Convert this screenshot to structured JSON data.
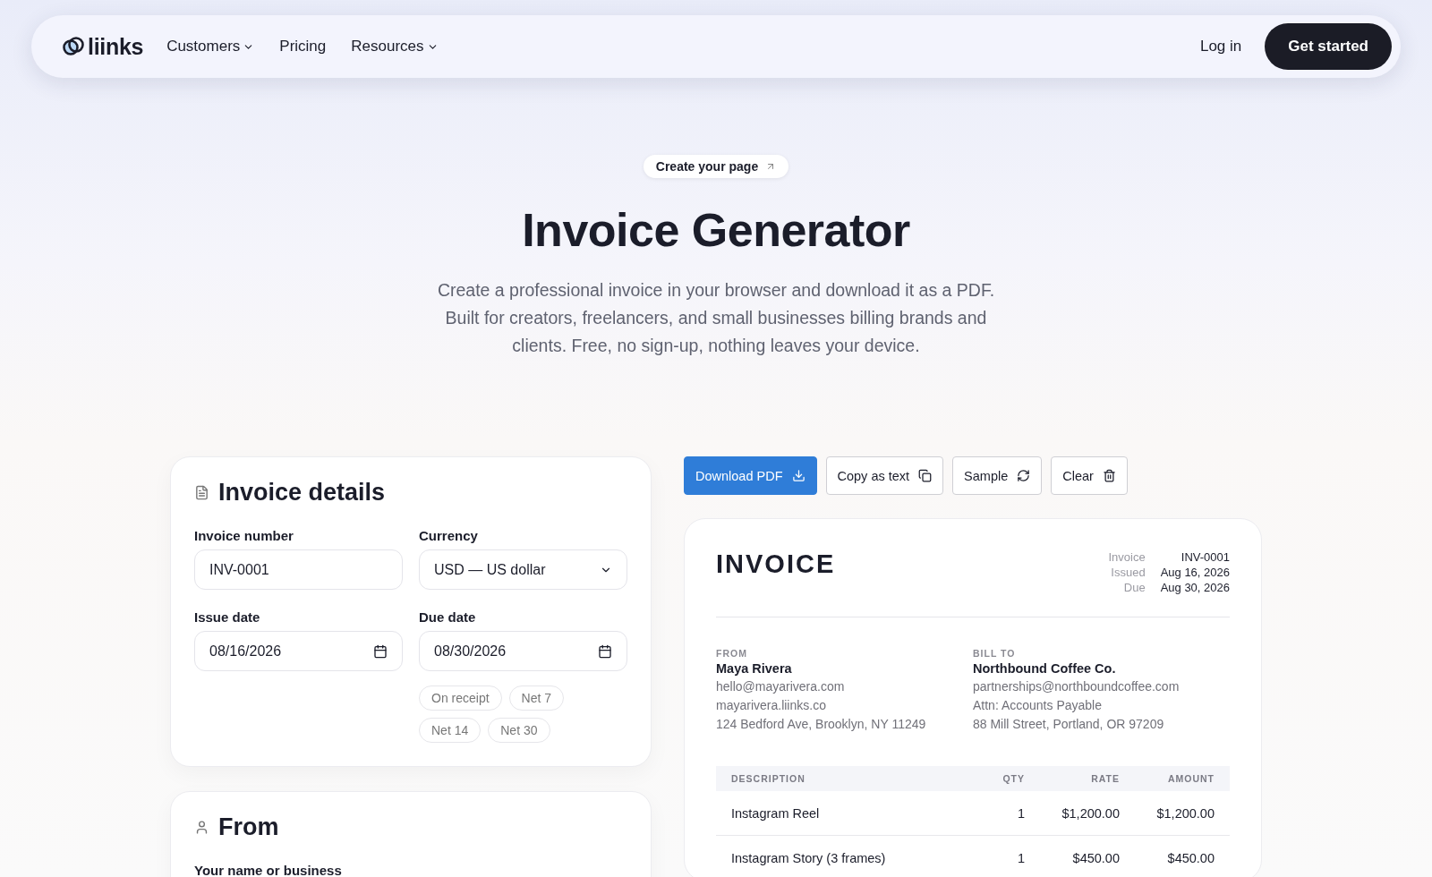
{
  "nav": {
    "logo": "liinks",
    "links": [
      {
        "label": "Customers",
        "dropdown": true
      },
      {
        "label": "Pricing",
        "dropdown": false
      },
      {
        "label": "Resources",
        "dropdown": true
      }
    ],
    "login": "Log in",
    "cta": "Get started"
  },
  "hero": {
    "badge": "Create your page",
    "title": "Invoice Generator",
    "subtitle": "Create a professional invoice in your browser and download it as a PDF. Built for creators, freelancers, and small businesses billing brands and clients. Free, no sign-up, nothing leaves your device."
  },
  "details": {
    "title": "Invoice details",
    "fields": [
      {
        "label": "Invoice number",
        "value": "INV-0001",
        "kind": "text"
      },
      {
        "label": "Currency",
        "value": "USD — US dollar",
        "kind": "select"
      },
      {
        "label": "Issue date",
        "value": "08/16/2026",
        "kind": "date"
      },
      {
        "label": "Due date",
        "value": "08/30/2026",
        "kind": "date"
      }
    ],
    "terms": [
      "On receipt",
      "Net 7",
      "Net 14",
      "Net 30"
    ]
  },
  "from_card": {
    "title": "From",
    "field_label": "Your name or business"
  },
  "actions": [
    {
      "label": "Download PDF",
      "kind": "primary"
    },
    {
      "label": "Copy as text",
      "kind": "secondary"
    },
    {
      "label": "Sample",
      "kind": "secondary"
    },
    {
      "label": "Clear",
      "kind": "secondary"
    }
  ],
  "preview": {
    "title": "INVOICE",
    "meta": [
      {
        "label": "Invoice",
        "value": "INV-0001"
      },
      {
        "label": "Issued",
        "value": "Aug 16, 2026"
      },
      {
        "label": "Due",
        "value": "Aug 30, 2026"
      }
    ],
    "parties": [
      {
        "heading": "FROM",
        "name": "Maya Rivera",
        "lines": [
          "hello@mayarivera.com",
          "mayarivera.liinks.co",
          "124 Bedford Ave, Brooklyn, NY 11249"
        ]
      },
      {
        "heading": "BILL TO",
        "name": "Northbound Coffee Co.",
        "lines": [
          "partnerships@northboundcoffee.com",
          "Attn: Accounts Payable",
          "88 Mill Street, Portland, OR 97209"
        ]
      }
    ],
    "columns": [
      "DESCRIPTION",
      "QTY",
      "RATE",
      "AMOUNT"
    ],
    "rows": [
      [
        "Instagram Reel",
        "1",
        "$1,200.00",
        "$1,200.00"
      ],
      [
        "Instagram Story (3 frames)",
        "1",
        "$450.00",
        "$450.00"
      ]
    ]
  }
}
